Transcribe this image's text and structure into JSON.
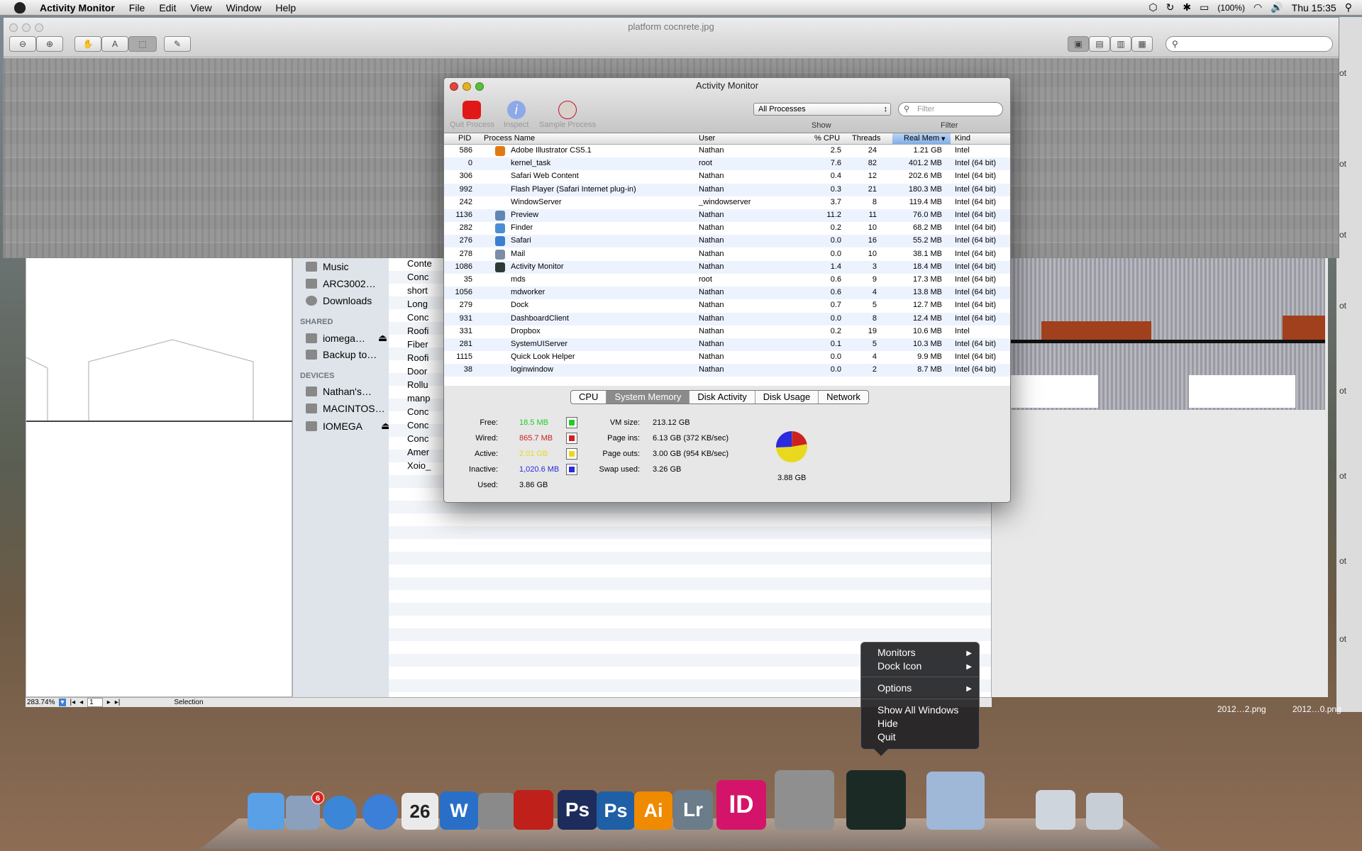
{
  "menubar": {
    "app": "Activity Monitor",
    "items": [
      "File",
      "Edit",
      "View",
      "Window",
      "Help"
    ],
    "battery": "(100%)",
    "clock": "Thu 15:35"
  },
  "preview": {
    "title": "platform cocnrete.jpg",
    "zoom": "283.74%",
    "page": "1",
    "mode": "Selection"
  },
  "finder": {
    "sidebar": [
      {
        "label": "Music"
      },
      {
        "label": "ARC3002…"
      },
      {
        "label": "Downloads"
      }
    ],
    "shared_header": "SHARED",
    "shared": [
      {
        "label": "iomega…"
      },
      {
        "label": "Backup to…"
      }
    ],
    "devices_header": "DEVICES",
    "devices": [
      {
        "label": "Nathan's…"
      },
      {
        "label": "MACINTOS…"
      },
      {
        "label": "IOMEGA"
      }
    ],
    "files": [
      "Conte",
      "Conc",
      "short",
      "Long",
      "Conc",
      "Roofi",
      "Fiber",
      "Roofi",
      "Door",
      "Rollu",
      "manp",
      "Conc",
      "Conc",
      "Conc",
      "Amer",
      "Xoio_"
    ]
  },
  "desktop_files": [
    "2012…2.png",
    "2012…0.png"
  ],
  "desktop_stub": "ot",
  "am": {
    "title": "Activity Monitor",
    "toolbar": {
      "quit": "Quit Process",
      "inspect": "Inspect",
      "sample": "Sample Process",
      "show_value": "All Processes",
      "show_label": "Show",
      "filter_placeholder": "Filter",
      "filter_label": "Filter"
    },
    "columns": {
      "pid": "PID",
      "name": "Process Name",
      "user": "User",
      "cpu": "% CPU",
      "threads": "Threads",
      "mem": "Real Mem",
      "kind": "Kind"
    },
    "processes": [
      {
        "pid": "586",
        "name": "Adobe Illustrator CS5.1",
        "user": "Nathan",
        "cpu": "2.5",
        "threads": "24",
        "mem": "1.21 GB",
        "kind": "Intel",
        "icon": "#e07a12"
      },
      {
        "pid": "0",
        "name": "kernel_task",
        "user": "root",
        "cpu": "7.6",
        "threads": "82",
        "mem": "401.2 MB",
        "kind": "Intel (64 bit)",
        "icon": ""
      },
      {
        "pid": "306",
        "name": "Safari Web Content",
        "user": "Nathan",
        "cpu": "0.4",
        "threads": "12",
        "mem": "202.6 MB",
        "kind": "Intel (64 bit)",
        "icon": ""
      },
      {
        "pid": "992",
        "name": "Flash Player (Safari Internet plug-in)",
        "user": "Nathan",
        "cpu": "0.3",
        "threads": "21",
        "mem": "180.3 MB",
        "kind": "Intel (64 bit)",
        "icon": ""
      },
      {
        "pid": "242",
        "name": "WindowServer",
        "user": "_windowserver",
        "cpu": "3.7",
        "threads": "8",
        "mem": "119.4 MB",
        "kind": "Intel (64 bit)",
        "icon": ""
      },
      {
        "pid": "1136",
        "name": "Preview",
        "user": "Nathan",
        "cpu": "11.2",
        "threads": "11",
        "mem": "76.0 MB",
        "kind": "Intel (64 bit)",
        "icon": "#5f86b5"
      },
      {
        "pid": "282",
        "name": "Finder",
        "user": "Nathan",
        "cpu": "0.2",
        "threads": "10",
        "mem": "68.2 MB",
        "kind": "Intel (64 bit)",
        "icon": "#4a8fd6"
      },
      {
        "pid": "276",
        "name": "Safari",
        "user": "Nathan",
        "cpu": "0.0",
        "threads": "16",
        "mem": "55.2 MB",
        "kind": "Intel (64 bit)",
        "icon": "#3a7fd0"
      },
      {
        "pid": "278",
        "name": "Mail",
        "user": "Nathan",
        "cpu": "0.0",
        "threads": "10",
        "mem": "38.1 MB",
        "kind": "Intel (64 bit)",
        "icon": "#7a8ea8"
      },
      {
        "pid": "1086",
        "name": "Activity Monitor",
        "user": "Nathan",
        "cpu": "1.4",
        "threads": "3",
        "mem": "18.4 MB",
        "kind": "Intel (64 bit)",
        "icon": "#2e3a36"
      },
      {
        "pid": "35",
        "name": "mds",
        "user": "root",
        "cpu": "0.6",
        "threads": "9",
        "mem": "17.3 MB",
        "kind": "Intel (64 bit)",
        "icon": ""
      },
      {
        "pid": "1056",
        "name": "mdworker",
        "user": "Nathan",
        "cpu": "0.6",
        "threads": "4",
        "mem": "13.8 MB",
        "kind": "Intel (64 bit)",
        "icon": ""
      },
      {
        "pid": "279",
        "name": "Dock",
        "user": "Nathan",
        "cpu": "0.7",
        "threads": "5",
        "mem": "12.7 MB",
        "kind": "Intel (64 bit)",
        "icon": ""
      },
      {
        "pid": "931",
        "name": "DashboardClient",
        "user": "Nathan",
        "cpu": "0.0",
        "threads": "8",
        "mem": "12.4 MB",
        "kind": "Intel (64 bit)",
        "icon": ""
      },
      {
        "pid": "331",
        "name": "Dropbox",
        "user": "Nathan",
        "cpu": "0.2",
        "threads": "19",
        "mem": "10.6 MB",
        "kind": "Intel",
        "icon": ""
      },
      {
        "pid": "281",
        "name": "SystemUIServer",
        "user": "Nathan",
        "cpu": "0.1",
        "threads": "5",
        "mem": "10.3 MB",
        "kind": "Intel (64 bit)",
        "icon": ""
      },
      {
        "pid": "1115",
        "name": "Quick Look Helper",
        "user": "Nathan",
        "cpu": "0.0",
        "threads": "4",
        "mem": "9.9 MB",
        "kind": "Intel (64 bit)",
        "icon": ""
      },
      {
        "pid": "38",
        "name": "loginwindow",
        "user": "Nathan",
        "cpu": "0.0",
        "threads": "2",
        "mem": "8.7 MB",
        "kind": "Intel (64 bit)",
        "icon": ""
      }
    ],
    "tabs": [
      {
        "label": "CPU",
        "active": false
      },
      {
        "label": "System Memory",
        "active": true
      },
      {
        "label": "Disk Activity",
        "active": false
      },
      {
        "label": "Disk Usage",
        "active": false
      },
      {
        "label": "Network",
        "active": false
      }
    ],
    "memory": {
      "free_label": "Free:",
      "free": "18.5 MB",
      "free_color": "#22cc22",
      "wired_label": "Wired:",
      "wired": "865.7 MB",
      "wired_color": "#cc2222",
      "active_label": "Active:",
      "active": "2.01 GB",
      "active_color": "#e8d91e",
      "inactive_label": "Inactive:",
      "inactive": "1,020.6 MB",
      "inactive_color": "#2a2ae0",
      "used_label": "Used:",
      "used": "3.86 GB",
      "vm_label": "VM size:",
      "vm": "213.12 GB",
      "pageins_label": "Page ins:",
      "pageins": "6.13 GB (372 KB/sec)",
      "pageouts_label": "Page outs:",
      "pageouts": "3.00 GB (954 KB/sec)",
      "swap_label": "Swap used:",
      "swap": "3.26 GB",
      "total": "3.88 GB",
      "pie": [
        {
          "name": "Free",
          "value": 18.5,
          "color": "#22cc22"
        },
        {
          "name": "Wired",
          "value": 865.7,
          "color": "#cc2222"
        },
        {
          "name": "Active",
          "value": 2058,
          "color": "#e8d91e"
        },
        {
          "name": "Inactive",
          "value": 1020.6,
          "color": "#2a2ae0"
        }
      ]
    }
  },
  "dock_menu": {
    "items": [
      {
        "label": "Monitors",
        "submenu": true
      },
      {
        "label": "Dock Icon",
        "submenu": true
      },
      {
        "label": "Options",
        "submenu": true
      },
      {
        "label": "Show All Windows",
        "submenu": false
      },
      {
        "label": "Hide",
        "submenu": false
      },
      {
        "label": "Quit",
        "submenu": false
      }
    ]
  },
  "dock": [
    {
      "name": "finder",
      "label": "",
      "color": "#5aa0e6"
    },
    {
      "name": "mail",
      "label": "",
      "color": "#8aa0bd",
      "badge": "6"
    },
    {
      "name": "safari",
      "label": "",
      "color": "#3b86d6"
    },
    {
      "name": "itunes",
      "label": "",
      "color": "#3c7fd8"
    },
    {
      "name": "ical",
      "label": "26",
      "color": "#eaeaea"
    },
    {
      "name": "word",
      "label": "W",
      "color": "#2a6fc7"
    },
    {
      "name": "sketchup",
      "label": "",
      "color": "#8a8a8a"
    },
    {
      "name": "autocad",
      "label": "",
      "color": "#c0201a"
    },
    {
      "name": "photoshop-cs5",
      "label": "Ps",
      "color": "#1d2c5b"
    },
    {
      "name": "photoshop",
      "label": "Ps",
      "color": "#1f5fa6"
    },
    {
      "name": "illustrator",
      "label": "Ai",
      "color": "#f08a00"
    },
    {
      "name": "lightroom",
      "label": "Lr",
      "color": "#6b7c8a"
    },
    {
      "name": "indesign",
      "label": "ID",
      "color": "#d4146a"
    },
    {
      "name": "system-preferences",
      "label": "",
      "color": "#8f8f8f"
    },
    {
      "name": "activity-monitor",
      "label": "",
      "color": "#1c2a26"
    },
    {
      "name": "iphoto",
      "label": "",
      "color": "#9fb8d8"
    },
    {
      "name": "printer",
      "label": "",
      "color": "#cfd5dd"
    },
    {
      "name": "trash",
      "label": "",
      "color": "#c8ced6"
    }
  ]
}
